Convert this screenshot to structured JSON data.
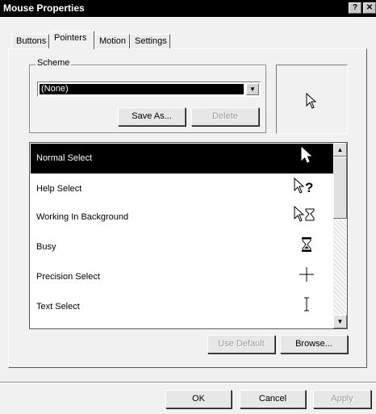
{
  "window": {
    "title": "Mouse Properties",
    "help_glyph": "?",
    "close_glyph": "✕"
  },
  "tabs": [
    {
      "label": "Buttons"
    },
    {
      "label": "Pointers"
    },
    {
      "label": "Motion"
    },
    {
      "label": "Settings"
    }
  ],
  "scheme": {
    "group_label": "Scheme",
    "selected_value": "(None)",
    "save_as_label": "Save As...",
    "delete_label": "Delete"
  },
  "cursor_list": [
    {
      "label": "Normal Select",
      "icon": "arrow-pointer-icon"
    },
    {
      "label": "Help Select",
      "icon": "help-pointer-icon"
    },
    {
      "label": "Working In Background",
      "icon": "working-pointer-icon"
    },
    {
      "label": "Busy",
      "icon": "hourglass-icon"
    },
    {
      "label": "Precision Select",
      "icon": "crosshair-icon"
    },
    {
      "label": "Text Select",
      "icon": "ibeam-icon"
    }
  ],
  "buttons": {
    "use_default": "Use Default",
    "browse": "Browse...",
    "ok": "OK",
    "cancel": "Cancel",
    "apply": "Apply"
  }
}
